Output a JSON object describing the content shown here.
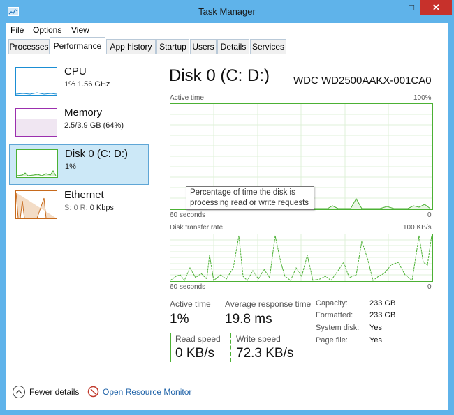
{
  "window": {
    "title": "Task Manager",
    "min_label": "–",
    "max_label": "□",
    "close_label": "✕"
  },
  "menu": [
    "File",
    "Options",
    "View"
  ],
  "tabs": [
    "Processes",
    "Performance",
    "App history",
    "Startup",
    "Users",
    "Details",
    "Services"
  ],
  "active_tab": "Performance",
  "sidebar": [
    {
      "name": "CPU",
      "stat": "1%  1.56 GHz",
      "color": "#1b8ed4"
    },
    {
      "name": "Memory",
      "stat": "2.5/3.9 GB (64%)",
      "color": "#9b2fae"
    },
    {
      "name": "Disk 0 (C: D:)",
      "stat": "1%",
      "color": "#4cb134"
    },
    {
      "name": "Ethernet",
      "stat_prefix": "S: 0 R: ",
      "stat": "0 Kbps",
      "color": "#c76a1c"
    }
  ],
  "main": {
    "title": "Disk 0 (C: D:)",
    "device": "WDC WD2500AAKX-001CA0",
    "graph1": {
      "label": "Active time",
      "max_label": "100%",
      "x_left": "60 seconds",
      "x_right": "0",
      "tooltip": "Percentage of time the disk is processing read or write requests"
    },
    "graph2": {
      "label": "Disk transfer rate",
      "max_label": "100 KB/s",
      "x_left": "60 seconds",
      "x_right": "0"
    },
    "stats": {
      "active_time_label": "Active time",
      "active_time_value": "1%",
      "avg_resp_label": "Average response time",
      "avg_resp_value": "19.8 ms",
      "read_label": "Read speed",
      "read_value": "0 KB/s",
      "write_label": "Write speed",
      "write_value": "72.3 KB/s"
    },
    "details": [
      {
        "key": "Capacity:",
        "value": "233 GB"
      },
      {
        "key": "Formatted:",
        "value": "233 GB"
      },
      {
        "key": "System disk:",
        "value": "Yes"
      },
      {
        "key": "Page file:",
        "value": "Yes"
      }
    ]
  },
  "footer": {
    "fewer_details": "Fewer details",
    "open_resource_monitor": "Open Resource Monitor"
  },
  "colors": {
    "disk_green": "#4cb134",
    "accent_blue": "#1b8ed4",
    "selection_bg": "#cce8f7"
  }
}
